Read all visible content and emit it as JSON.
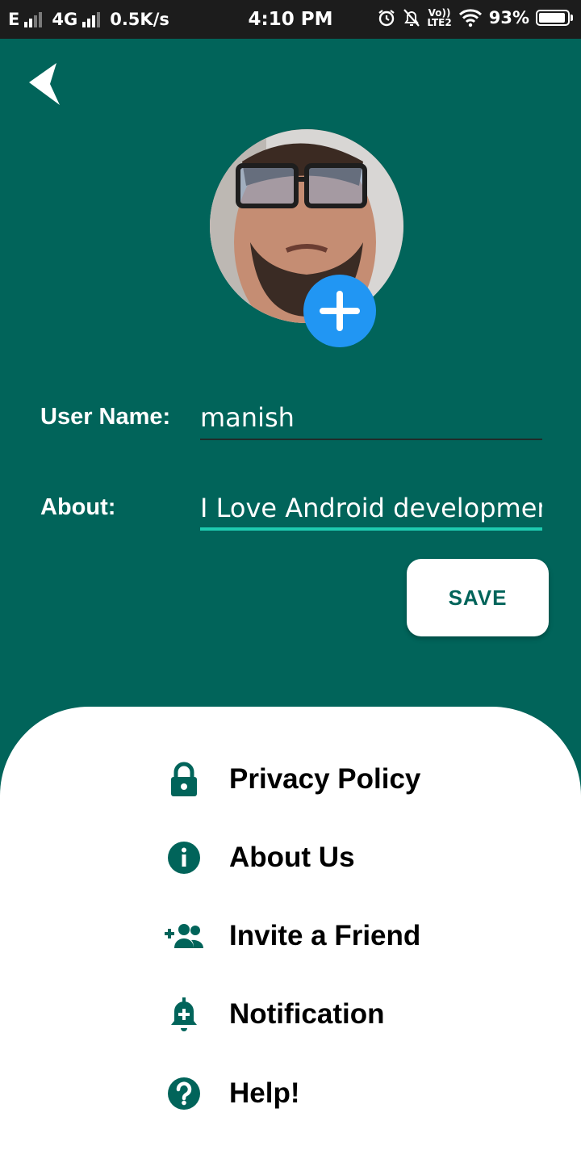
{
  "status_bar": {
    "network_type_1": "E",
    "network_type_2": "4G",
    "speed": "0.5K/s",
    "time": "4:10 PM",
    "volte_top": "Vo))",
    "volte_bottom": "LTE2",
    "battery": "93%",
    "icons": [
      "signal-icon",
      "alarm-icon",
      "notifications-off-icon",
      "wifi-icon",
      "battery-icon"
    ]
  },
  "header": {
    "back_icon": "chevron-left-icon"
  },
  "profile": {
    "avatar_icon": "profile-photo",
    "add_photo_icon": "plus-icon",
    "add_photo_color": "#2196f3"
  },
  "form": {
    "username_label": "User Name:",
    "username_value": "manish",
    "about_label": "About:",
    "about_value": "I Love Android development",
    "save_label": "SAVE"
  },
  "menu": {
    "items": [
      {
        "label": "Privacy Policy",
        "icon": "lock-icon"
      },
      {
        "label": "About Us",
        "icon": "info-icon"
      },
      {
        "label": "Invite a Friend",
        "icon": "group-add-icon"
      },
      {
        "label": "Notification",
        "icon": "bell-plus-icon"
      },
      {
        "label": "Help!",
        "icon": "help-icon"
      }
    ]
  },
  "colors": {
    "primary": "#01645a",
    "accent": "#00bfa5",
    "fab": "#2196f3"
  }
}
